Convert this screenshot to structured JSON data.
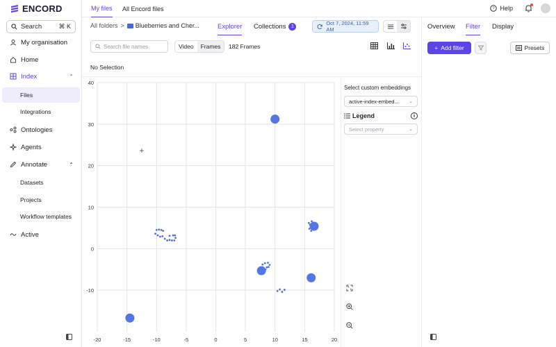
{
  "brand": {
    "name": "ENCORD",
    "accent": "#5b44e6"
  },
  "sidebar": {
    "search_label": "Search",
    "search_shortcut": "⌘ K",
    "items": [
      {
        "label": "My organisation",
        "icon": "org-icon"
      },
      {
        "label": "Home",
        "icon": "home-icon"
      },
      {
        "label": "Index",
        "icon": "index-icon",
        "expanded": true
      },
      {
        "label": "Ontologies",
        "icon": "ontology-icon"
      },
      {
        "label": "Agents",
        "icon": "agents-icon"
      },
      {
        "label": "Annotate",
        "icon": "annotate-icon",
        "expanded": true
      },
      {
        "label": "Active",
        "icon": "active-icon"
      }
    ],
    "index_children": [
      "Files",
      "Integrations"
    ],
    "annotate_children": [
      "Datasets",
      "Projects",
      "Workflow templates"
    ]
  },
  "topbar": {
    "tabs": [
      "My files",
      "All Encord files"
    ],
    "help_label": "Help"
  },
  "explorer": {
    "breadcrumb_root": "All folders",
    "breadcrumb_sep": ">",
    "breadcrumb_folder": "Blueberries and Cher...",
    "tabs": {
      "explorer": "Explorer",
      "collections": "Collections",
      "collections_count": "1"
    },
    "date": "Oct 7, 2024, 11:59 AM",
    "search_placeholder": "Search file names",
    "mode_video": "Video",
    "mode_frames": "Frames",
    "frames_count": "182 Frames",
    "selection_status": "No Selection"
  },
  "embeddings": {
    "title": "Select custom embeddings",
    "selected": "active-index-embed...",
    "legend_label": "Legend",
    "property_placeholder": "Select property"
  },
  "right_panel": {
    "tabs": [
      "Overview",
      "Filter",
      "Display"
    ],
    "add_filter": "Add filter",
    "presets": "Presets"
  },
  "chart_data": {
    "type": "scatter",
    "title": "",
    "xlabel": "",
    "ylabel": "",
    "xlim": [
      -20,
      20
    ],
    "ylim": [
      -20,
      40
    ],
    "xticks": [
      -20,
      -15,
      -10,
      -5,
      0,
      5,
      10,
      15,
      20
    ],
    "yticks": [
      -10,
      0,
      10,
      20,
      30,
      40
    ],
    "grid": true,
    "point_color": "#4a6fe3",
    "large_points": [
      {
        "x": 10,
        "y": 31.2
      },
      {
        "x": 16.6,
        "y": 5.4
      },
      {
        "x": 7.7,
        "y": -5.3
      },
      {
        "x": 16.1,
        "y": -7.0
      },
      {
        "x": -14.5,
        "y": -16.7
      }
    ],
    "small_points": [
      {
        "x": -10,
        "y": 4.5
      },
      {
        "x": -9.6,
        "y": 4.6
      },
      {
        "x": -9.2,
        "y": 4.5
      },
      {
        "x": -8.9,
        "y": 4.3
      },
      {
        "x": -10.2,
        "y": 3.6
      },
      {
        "x": -9.8,
        "y": 3.2
      },
      {
        "x": -9.4,
        "y": 2.9
      },
      {
        "x": -9.0,
        "y": 3.0
      },
      {
        "x": -8.6,
        "y": 2.4
      },
      {
        "x": -8.2,
        "y": 2.0
      },
      {
        "x": -7.8,
        "y": 2.1
      },
      {
        "x": -7.4,
        "y": 2.0
      },
      {
        "x": -7.0,
        "y": 2.0
      },
      {
        "x": -6.8,
        "y": 2.6
      },
      {
        "x": -7.2,
        "y": 3.2
      },
      {
        "x": -7.8,
        "y": 3.1
      },
      {
        "x": -6.9,
        "y": 3.2
      },
      {
        "x": 7.9,
        "y": -3.8
      },
      {
        "x": 8.3,
        "y": -3.5
      },
      {
        "x": 8.8,
        "y": -3.4
      },
      {
        "x": 9.1,
        "y": -3.9
      },
      {
        "x": 8.6,
        "y": -4.5
      },
      {
        "x": 8.9,
        "y": -4.4
      },
      {
        "x": 8.4,
        "y": -5.0
      },
      {
        "x": 10.4,
        "y": -10.2
      },
      {
        "x": 10.8,
        "y": -9.8
      },
      {
        "x": 11.2,
        "y": -10.4
      },
      {
        "x": 11.6,
        "y": -9.9
      },
      {
        "x": 15.7,
        "y": 6.2
      },
      {
        "x": 15.9,
        "y": 5.8
      },
      {
        "x": 15.8,
        "y": 4.8
      },
      {
        "x": 16.1,
        "y": 4.3
      },
      {
        "x": 16.2,
        "y": 6.6
      }
    ],
    "marker": {
      "x": -12.5,
      "y": 23.6,
      "symbol": "+"
    }
  }
}
